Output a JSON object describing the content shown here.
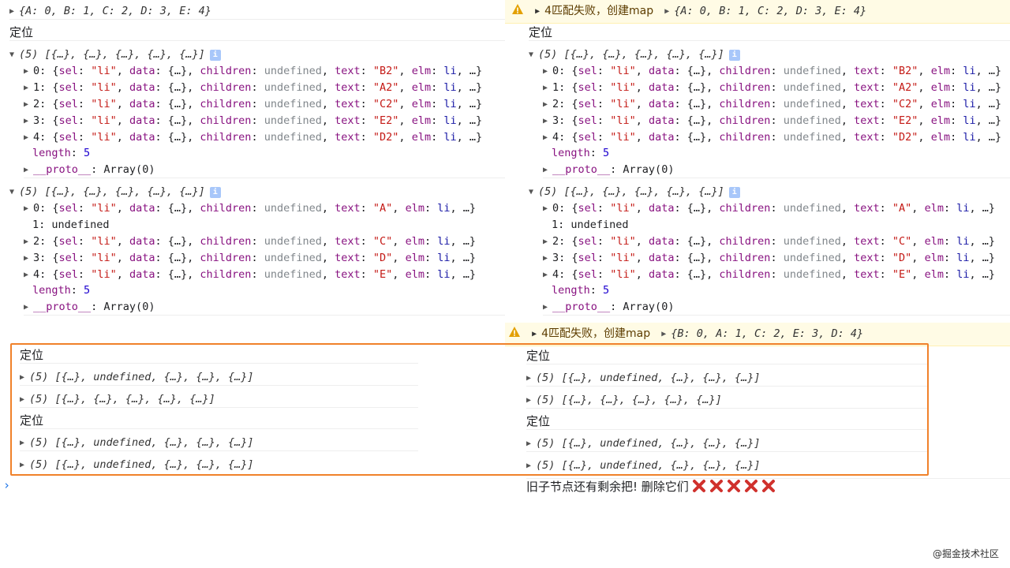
{
  "console_top": {
    "left_obj_preview": "{A: 0, B: 1, C: 2, D: 3, E: 4}",
    "right_warning_label": "4匹配失败，创建map",
    "right_warning_obj": "{A: 0, B: 1, C: 2, D: 3, E: 4}"
  },
  "locate_label": "定位",
  "array_preview": "(5) [{…}, {…}, {…}, {…}, {…}]",
  "array_preview_undef": "(5) [{…}, undefined, {…}, {…}, {…}]",
  "group1_items": [
    {
      "idx": "0",
      "text": "\"B2\""
    },
    {
      "idx": "1",
      "text": "\"A2\""
    },
    {
      "idx": "2",
      "text": "\"C2\""
    },
    {
      "idx": "3",
      "text": "\"E2\""
    },
    {
      "idx": "4",
      "text": "\"D2\""
    }
  ],
  "group2_items": [
    {
      "idx": "0",
      "text": "\"A\""
    },
    {
      "idx": "2",
      "text": "\"C\""
    },
    {
      "idx": "3",
      "text": "\"D\""
    },
    {
      "idx": "4",
      "text": "\"E\""
    }
  ],
  "item_parts": {
    "sel_key": "sel",
    "sel_val": "\"li\"",
    "data_key": "data",
    "data_val": "{…}",
    "children_key": "children",
    "children_val": "undefined",
    "text_key": "text",
    "elm_key": "elm",
    "elm_val": "li",
    "ellipsis_left": "…}",
    "ellipsis_right": "…"
  },
  "undefined_entry": "1: undefined",
  "length_key": "length",
  "length_val": "5",
  "proto_key": "__proto__",
  "proto_val": "Array(0)",
  "second_warning": {
    "label": "4匹配失败，创建map",
    "obj": "{B: 0, A: 1, C: 2, E: 3, D: 4}"
  },
  "final_message": "旧子节点还有剩余把! 删除它们",
  "x_count": 5,
  "prompt_glyph": "›",
  "watermark": "@掘金技术社区",
  "colors": {
    "highlight_border": "#f0812a",
    "warning_bg": "#fffbe5",
    "key": "#881280",
    "string": "#c41a16",
    "undefined": "#80868b"
  }
}
